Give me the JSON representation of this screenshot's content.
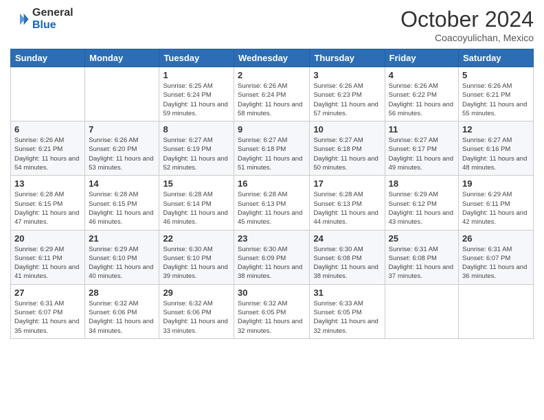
{
  "logo": {
    "general": "General",
    "blue": "Blue"
  },
  "title": "October 2024",
  "location": "Coacoyulichan, Mexico",
  "days_of_week": [
    "Sunday",
    "Monday",
    "Tuesday",
    "Wednesday",
    "Thursday",
    "Friday",
    "Saturday"
  ],
  "weeks": [
    [
      {
        "day": "",
        "info": ""
      },
      {
        "day": "",
        "info": ""
      },
      {
        "day": "1",
        "info": "Sunrise: 6:25 AM\nSunset: 6:24 PM\nDaylight: 11 hours and 59 minutes."
      },
      {
        "day": "2",
        "info": "Sunrise: 6:26 AM\nSunset: 6:24 PM\nDaylight: 11 hours and 58 minutes."
      },
      {
        "day": "3",
        "info": "Sunrise: 6:26 AM\nSunset: 6:23 PM\nDaylight: 11 hours and 57 minutes."
      },
      {
        "day": "4",
        "info": "Sunrise: 6:26 AM\nSunset: 6:22 PM\nDaylight: 11 hours and 56 minutes."
      },
      {
        "day": "5",
        "info": "Sunrise: 6:26 AM\nSunset: 6:21 PM\nDaylight: 11 hours and 55 minutes."
      }
    ],
    [
      {
        "day": "6",
        "info": "Sunrise: 6:26 AM\nSunset: 6:21 PM\nDaylight: 11 hours and 54 minutes."
      },
      {
        "day": "7",
        "info": "Sunrise: 6:26 AM\nSunset: 6:20 PM\nDaylight: 11 hours and 53 minutes."
      },
      {
        "day": "8",
        "info": "Sunrise: 6:27 AM\nSunset: 6:19 PM\nDaylight: 11 hours and 52 minutes."
      },
      {
        "day": "9",
        "info": "Sunrise: 6:27 AM\nSunset: 6:18 PM\nDaylight: 11 hours and 51 minutes."
      },
      {
        "day": "10",
        "info": "Sunrise: 6:27 AM\nSunset: 6:18 PM\nDaylight: 11 hours and 50 minutes."
      },
      {
        "day": "11",
        "info": "Sunrise: 6:27 AM\nSunset: 6:17 PM\nDaylight: 11 hours and 49 minutes."
      },
      {
        "day": "12",
        "info": "Sunrise: 6:27 AM\nSunset: 6:16 PM\nDaylight: 11 hours and 48 minutes."
      }
    ],
    [
      {
        "day": "13",
        "info": "Sunrise: 6:28 AM\nSunset: 6:15 PM\nDaylight: 11 hours and 47 minutes."
      },
      {
        "day": "14",
        "info": "Sunrise: 6:28 AM\nSunset: 6:15 PM\nDaylight: 11 hours and 46 minutes."
      },
      {
        "day": "15",
        "info": "Sunrise: 6:28 AM\nSunset: 6:14 PM\nDaylight: 11 hours and 46 minutes."
      },
      {
        "day": "16",
        "info": "Sunrise: 6:28 AM\nSunset: 6:13 PM\nDaylight: 11 hours and 45 minutes."
      },
      {
        "day": "17",
        "info": "Sunrise: 6:28 AM\nSunset: 6:13 PM\nDaylight: 11 hours and 44 minutes."
      },
      {
        "day": "18",
        "info": "Sunrise: 6:29 AM\nSunset: 6:12 PM\nDaylight: 11 hours and 43 minutes."
      },
      {
        "day": "19",
        "info": "Sunrise: 6:29 AM\nSunset: 6:11 PM\nDaylight: 11 hours and 42 minutes."
      }
    ],
    [
      {
        "day": "20",
        "info": "Sunrise: 6:29 AM\nSunset: 6:11 PM\nDaylight: 11 hours and 41 minutes."
      },
      {
        "day": "21",
        "info": "Sunrise: 6:29 AM\nSunset: 6:10 PM\nDaylight: 11 hours and 40 minutes."
      },
      {
        "day": "22",
        "info": "Sunrise: 6:30 AM\nSunset: 6:10 PM\nDaylight: 11 hours and 39 minutes."
      },
      {
        "day": "23",
        "info": "Sunrise: 6:30 AM\nSunset: 6:09 PM\nDaylight: 11 hours and 38 minutes."
      },
      {
        "day": "24",
        "info": "Sunrise: 6:30 AM\nSunset: 6:08 PM\nDaylight: 11 hours and 38 minutes."
      },
      {
        "day": "25",
        "info": "Sunrise: 6:31 AM\nSunset: 6:08 PM\nDaylight: 11 hours and 37 minutes."
      },
      {
        "day": "26",
        "info": "Sunrise: 6:31 AM\nSunset: 6:07 PM\nDaylight: 11 hours and 36 minutes."
      }
    ],
    [
      {
        "day": "27",
        "info": "Sunrise: 6:31 AM\nSunset: 6:07 PM\nDaylight: 11 hours and 35 minutes."
      },
      {
        "day": "28",
        "info": "Sunrise: 6:32 AM\nSunset: 6:06 PM\nDaylight: 11 hours and 34 minutes."
      },
      {
        "day": "29",
        "info": "Sunrise: 6:32 AM\nSunset: 6:06 PM\nDaylight: 11 hours and 33 minutes."
      },
      {
        "day": "30",
        "info": "Sunrise: 6:32 AM\nSunset: 6:05 PM\nDaylight: 11 hours and 32 minutes."
      },
      {
        "day": "31",
        "info": "Sunrise: 6:33 AM\nSunset: 6:05 PM\nDaylight: 11 hours and 32 minutes."
      },
      {
        "day": "",
        "info": ""
      },
      {
        "day": "",
        "info": ""
      }
    ]
  ]
}
